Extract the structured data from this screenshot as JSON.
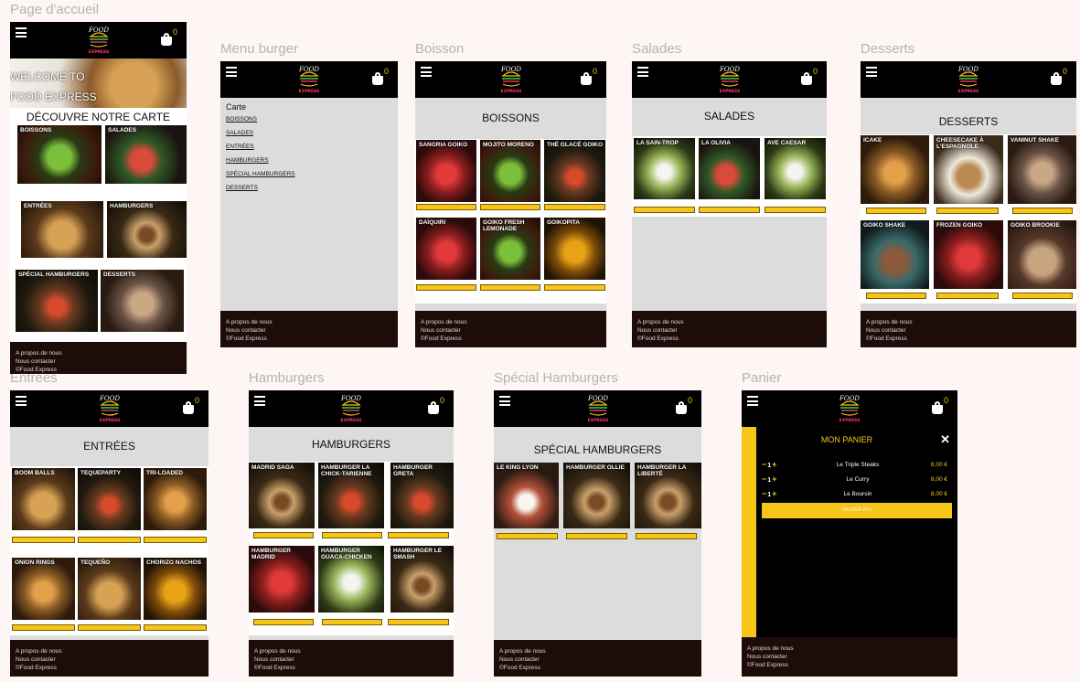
{
  "frames": {
    "home": "Page d'accueil",
    "menu": "Menu burger",
    "drinks": "Boisson",
    "salads": "Salades",
    "desserts": "Desserts",
    "starters": "Entrées",
    "burgers": "Hamburgers",
    "special": "Spécial Hamburgers",
    "cart": "Panier"
  },
  "header": {
    "logo_top": "FOOD",
    "logo_bottom": "EXPRESS",
    "cart_count": "0"
  },
  "home": {
    "welcome_line1": "WELCOME TO",
    "welcome_line2": "FOOD EXPRESS",
    "discover": "DÉCOUVRE NOTRE CARTE",
    "tiles": [
      "BOISSONS",
      "SALADES",
      "ENTRÉES",
      "HAMBURGERS",
      "SPÉCIAL HAMBURGERS",
      "DESSERTS"
    ]
  },
  "menu": {
    "heading": "Carte",
    "items": [
      "BOISSONS",
      "SALADES",
      "ENTRÉES",
      "HAMBURGERS",
      "SPÉCIAL HAMBURGERS",
      "DESSERTS"
    ]
  },
  "drinks": {
    "title": "BOISSONS",
    "items": [
      "SANGRIA GOIKO",
      "MOJITO MORENO",
      "THÉ GLACÉ GOIKO",
      "DAÏQUIRI",
      "GOIKO FRESH LEMONADE",
      "GOIKOPITA"
    ]
  },
  "salads": {
    "title": "SALADES",
    "items": [
      "LA SAIN-TROP",
      "LA OLIVIA",
      "AVE CAESAR"
    ]
  },
  "desserts": {
    "title": "DESSERTS",
    "items": [
      "ICAKE",
      "CHEESECAKE À L'ESPAGNOLE",
      "VANINUT SHAKE",
      "GOIKO SHAKE",
      "FROZEN GOIKO",
      "GOIKO BROOKIE"
    ]
  },
  "starters": {
    "title": "ENTRÉES",
    "items": [
      "BOOM BALLS",
      "TEQUEPARTY",
      "TRI-LOADED",
      "ONION RINGS",
      "TEQUEÑO",
      "CHORIZO NACHOS"
    ]
  },
  "burgers": {
    "title": "HAMBURGERS",
    "items": [
      "MADRID SAGA",
      "HAMBURGER LA CHICK-TARIENNE",
      "HAMBURGER GRETA",
      "HAMBURGER MADRID",
      "HAMBURGER GUACA-CHICKEN",
      "HAMBURGER LE SMASH"
    ]
  },
  "special": {
    "title": "SPÉCIAL HAMBURGERS",
    "items": [
      "LE KING LYON",
      "HAMBURGER OLLIE",
      "HAMBURGER LA LIBERTÉ"
    ]
  },
  "cart": {
    "title": "MON PANIER",
    "rows": [
      {
        "qty": "1",
        "name": "Le Triple Steaks",
        "price": "8,00 €"
      },
      {
        "qty": "1",
        "name": "Le Curry",
        "price": "8,00 €"
      },
      {
        "qty": "1",
        "name": "Le Boursin",
        "price": "8,00 €"
      }
    ],
    "validate": "VALIDER 24 €"
  },
  "footer": {
    "about": "A propos de nous",
    "contact": "Nous contacter",
    "copyright": "©Food Express"
  },
  "colors": {
    "accent": "#f5c518",
    "header_bg": "#000000",
    "footer_bg": "#1d0c08",
    "page_bg": "#dcdcdc"
  }
}
